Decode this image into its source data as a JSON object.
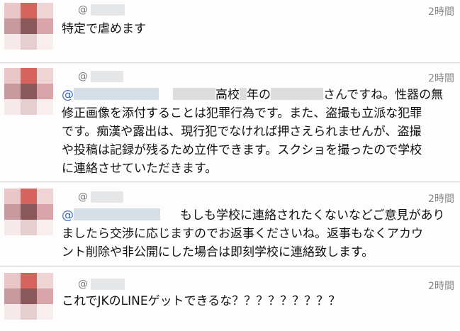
{
  "avatar_palette": [
    "#e9c6c8",
    "#d6645c",
    "#efd4d6",
    "#c79aa0",
    "#8a5858",
    "#d9a5aa",
    "#f5e9ea",
    "#e6cdd0",
    "#f8eeee"
  ],
  "tweets": [
    {
      "at": "@",
      "time": "2時間",
      "text": "特定で虐めます"
    },
    {
      "at": "@",
      "time": "2時間",
      "mention": "@",
      "t1": "高校",
      "t2": "年の",
      "t3": "さんですね。性器の無",
      "line2": "修正画像を添付することは犯罪行為です。また、盗撮も立派な犯罪",
      "line3": "です。痴漢や露出は、現行犯でなければ押さえられませんが、盗撮",
      "line4": "や投稿は記録が残るため立件できます。スクショを撮ったので学校",
      "line5": "に連絡させていただきます。"
    },
    {
      "at": "@",
      "time": "2時間",
      "mention": "@",
      "line1": "もしも学校に連絡されたくないなどご意見があり",
      "line2": "ましたら交渉に応じますのでお返事くださいね。返事もなくアカウ",
      "line3": "ント削除や非公開にした場合は即刻学校に連絡致します。"
    },
    {
      "at": "@",
      "time": "2時間",
      "text": "これでJKのLINEゲットできるな？？？？？？？？？"
    }
  ]
}
